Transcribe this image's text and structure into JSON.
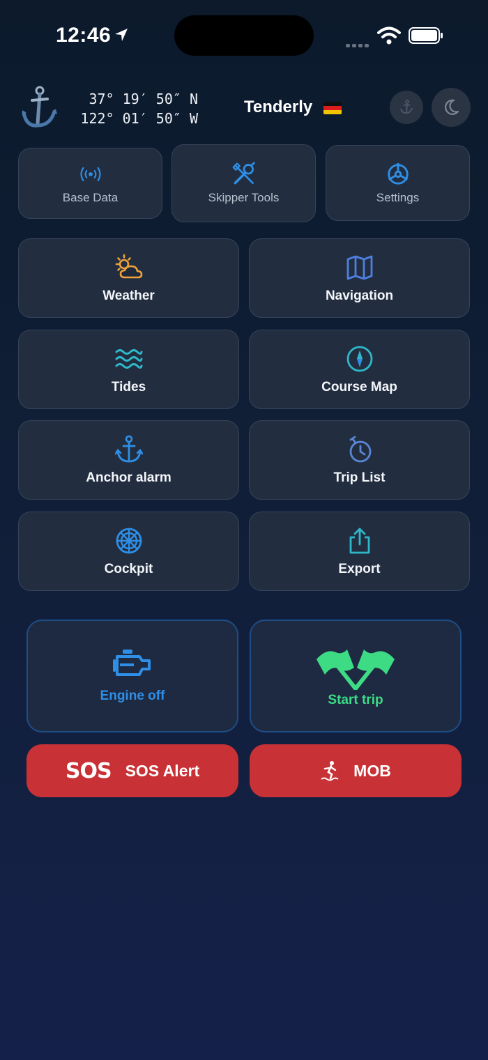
{
  "status_bar": {
    "time": "12:46"
  },
  "header": {
    "latitude": "37° 19′ 50″ N",
    "longitude": "122° 01′ 50″ W",
    "boat_name": "Tenderly"
  },
  "top_tiles": [
    {
      "label": "Base Data",
      "icon": "broadcast-icon"
    },
    {
      "label": "Skipper Tools",
      "icon": "tools-icon"
    },
    {
      "label": "Settings",
      "icon": "helm-gear-icon"
    }
  ],
  "tiles": [
    {
      "label": "Weather",
      "icon": "sun-cloud-icon"
    },
    {
      "label": "Navigation",
      "icon": "map-icon"
    },
    {
      "label": "Tides",
      "icon": "waves-icon"
    },
    {
      "label": "Course Map",
      "icon": "compass-icon"
    },
    {
      "label": "Anchor alarm",
      "icon": "anchor-icon"
    },
    {
      "label": "Trip List",
      "icon": "timer-icon"
    },
    {
      "label": "Cockpit",
      "icon": "steering-wheel-icon"
    },
    {
      "label": "Export",
      "icon": "share-icon"
    }
  ],
  "actions": {
    "engine_label": "Engine off",
    "trip_label": "Start trip"
  },
  "alerts": {
    "sos_mark": "SOS",
    "sos_label": "SOS Alert",
    "mob_label": "MOB"
  },
  "colors": {
    "engine": "#2f8fe6",
    "trip": "#3ddc84",
    "alert": "#c83236"
  }
}
